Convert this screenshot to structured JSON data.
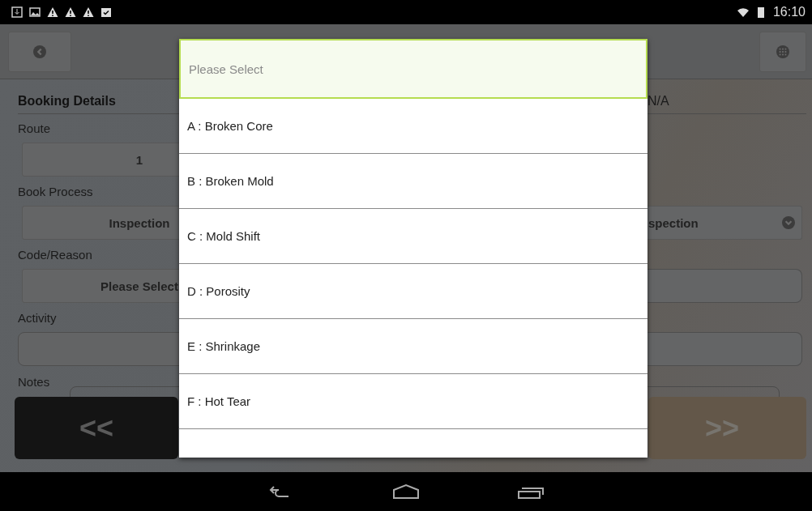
{
  "status_bar": {
    "time": "16:10"
  },
  "form": {
    "heading": "Booking Details",
    "heading_value": "N/A",
    "fields": [
      {
        "label": "Route",
        "value": "1",
        "kind": "select"
      },
      {
        "label": "Book Process",
        "value": "Inspection",
        "kind": "select",
        "right_field": {
          "kind": "select",
          "value": "spection"
        }
      },
      {
        "label": "Code/Reason",
        "value": "Please Select",
        "kind": "select",
        "right_field": {
          "kind": "text"
        }
      },
      {
        "label": "Activity",
        "kind": "text",
        "right_field": {
          "kind": "text"
        }
      }
    ],
    "notes_label": "Notes",
    "prev_button": "<<",
    "next_button": ">>"
  },
  "dropdown": {
    "options": [
      {
        "label": "Please Select",
        "selected": true
      },
      {
        "label": "A : Broken Core",
        "selected": false
      },
      {
        "label": "B : Broken Mold",
        "selected": false
      },
      {
        "label": "C : Mold Shift",
        "selected": false
      },
      {
        "label": "D : Porosity",
        "selected": false
      },
      {
        "label": "E : Shrinkage",
        "selected": false
      },
      {
        "label": "F : Hot Tear",
        "selected": false
      }
    ]
  }
}
